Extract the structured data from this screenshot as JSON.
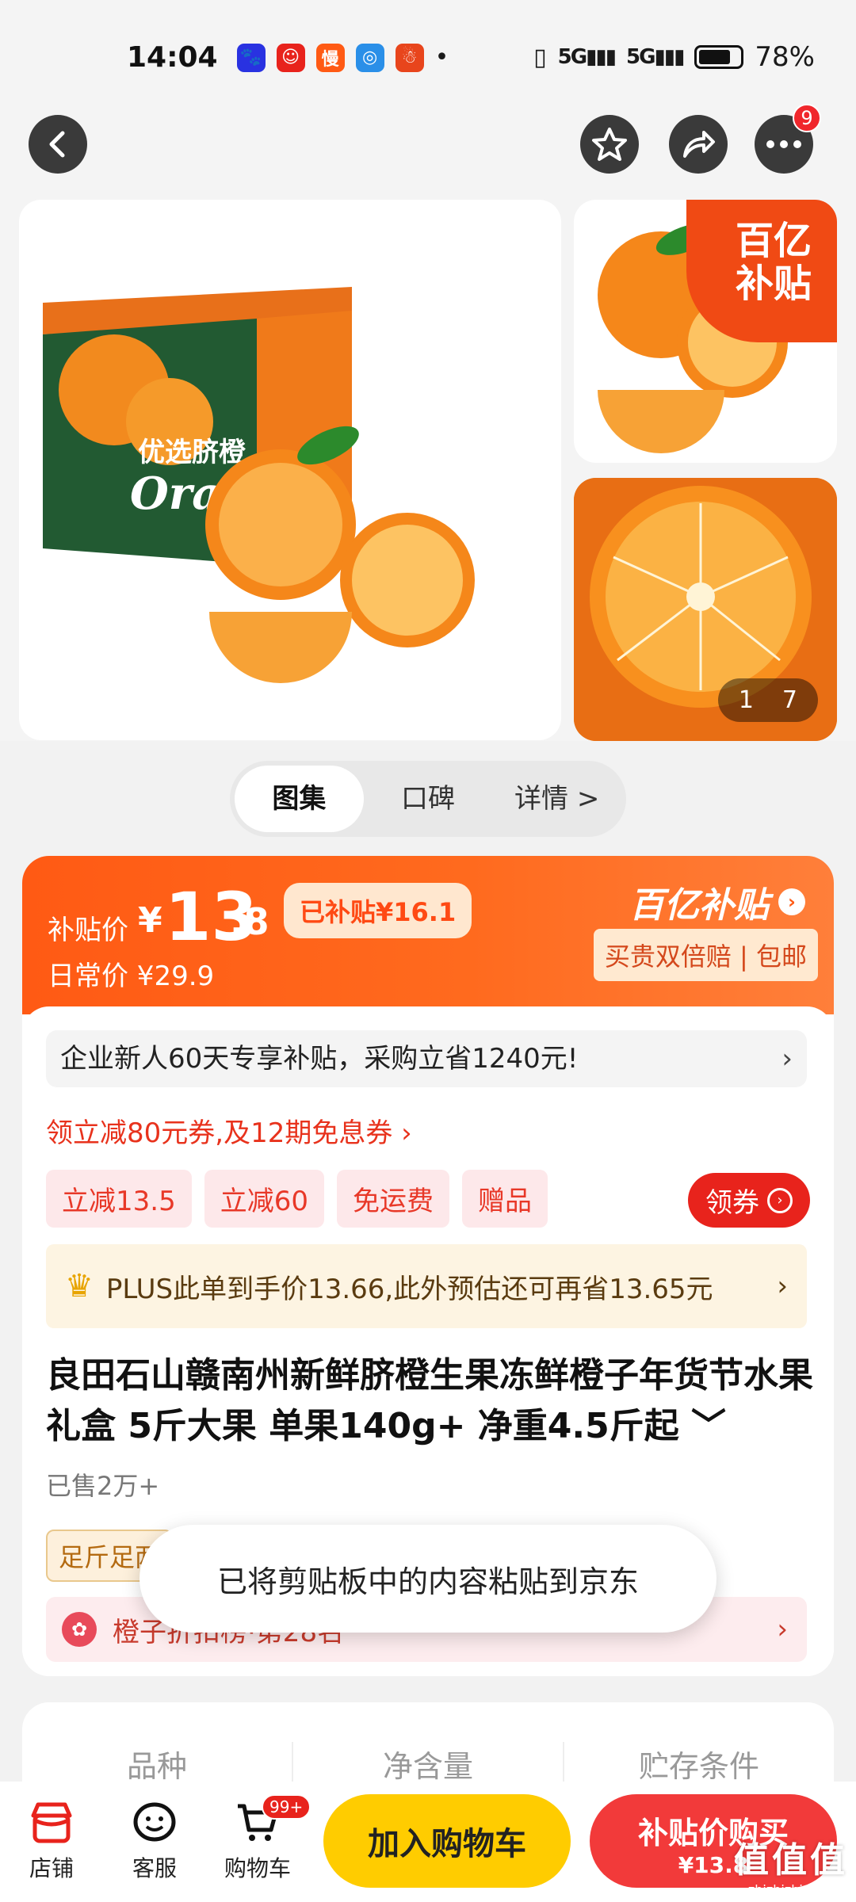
{
  "status_bar": {
    "time": "14:04",
    "apps": [
      {
        "icon": "baidu-icon",
        "color": "#2932e1",
        "glyph": "🐾"
      },
      {
        "icon": "app-red-icon",
        "color": "#e8231c",
        "glyph": "☺"
      },
      {
        "icon": "man-icon",
        "color": "#ff5a14",
        "glyph": "慢"
      },
      {
        "icon": "app-blue-icon",
        "color": "#2a8fe8",
        "glyph": "◎"
      },
      {
        "icon": "app-orange-icon",
        "color": "#e8451c",
        "glyph": "☃"
      }
    ],
    "dot": "•",
    "signal_1": "5G",
    "signal_2": "5G",
    "battery_percent": "78%",
    "battery_level": 0.78
  },
  "nav": {
    "more_badge": "9"
  },
  "gallery": {
    "box_title": "优选脐橙",
    "box_brand": "Orange",
    "corner_badge_line1": "百亿",
    "corner_badge_line2": "补贴",
    "pager_current": "1",
    "pager_total": "7"
  },
  "tabs": [
    {
      "label": "图集",
      "active": true
    },
    {
      "label": "口碑",
      "active": false
    },
    {
      "label": "详情 >",
      "active": false
    }
  ],
  "price": {
    "label": "补贴价",
    "yen": "¥",
    "int": "13",
    "dec": ".8",
    "subsidy_pill": "已补贴¥16.1",
    "daily_price": "日常价 ¥29.9",
    "brand": "百亿补贴",
    "brand_arrow": "›",
    "guarantee": "买贵双倍赔 | 包邮"
  },
  "promo": {
    "enterprise_text": "企业新人60天专享补贴，采购立省1240元!",
    "enterprise_chev": "›",
    "coupon_text": "领立减80元券,及12期免息券 ›",
    "chips": [
      "立减13.5",
      "立减60",
      "免运费",
      "赠品"
    ],
    "get_coupon_label": "领券",
    "plus_text": "PLUS此单到手价13.66,此外预估还可再省13.65元",
    "plus_chev": "›"
  },
  "product": {
    "title": "良田石山赣南州新鲜脐橙生果冻鲜橙子年货节水果礼盒 5斤大果 单果140g+ 净重4.5斤起 ﹀",
    "sold": "已售2万+",
    "feature_tag": "足斤足两",
    "rank_text": "橙子折扣榜·第28名",
    "rank_chev": "›"
  },
  "toast": {
    "text": "已将剪贴板中的内容粘贴到京东"
  },
  "specs": [
    "品种",
    "净含量",
    "贮存条件"
  ],
  "bottom_bar": {
    "store_label": "店铺",
    "service_label": "客服",
    "cart_label": "购物车",
    "cart_badge": "99+",
    "add_cart": "加入购物车",
    "buy_line1": "补贴价购买",
    "buy_line2": "¥13.8",
    "watermark_1": "值值值",
    "watermark_2": "zhizhizhi.com"
  },
  "colors": {
    "accent_orange": "#ff5a14",
    "jd_red": "#e8231c",
    "add_cart_yellow": "#ffcc00"
  }
}
